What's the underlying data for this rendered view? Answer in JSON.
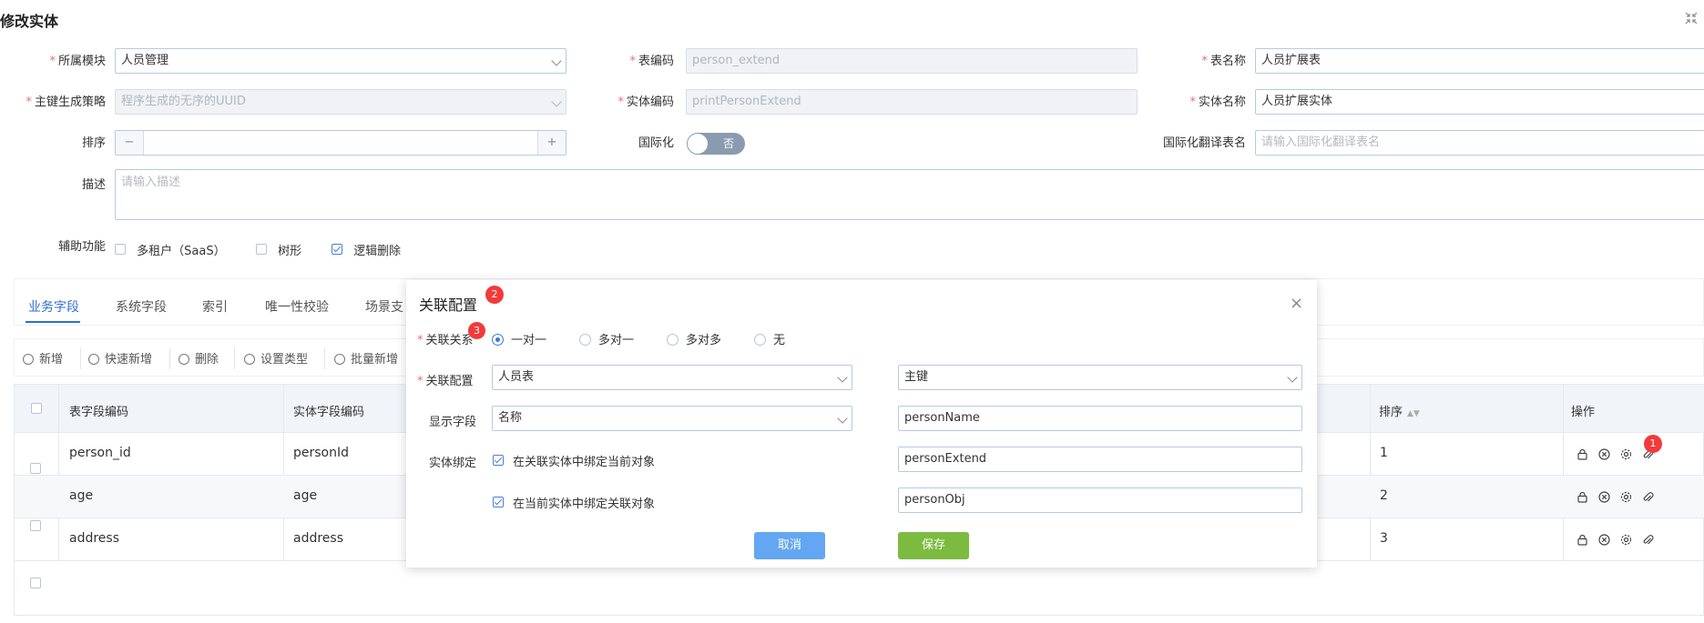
{
  "page": {
    "title": "修改实体"
  },
  "form": {
    "module": {
      "label": "所属模块",
      "value": "人员管理"
    },
    "table_code": {
      "label": "表编码",
      "value": "person_extend"
    },
    "table_name": {
      "label": "表名称",
      "value": "人员扩展表"
    },
    "pk_strategy": {
      "label": "主键生成策略",
      "value": "程序生成的无序的UUID"
    },
    "entity_code": {
      "label": "实体编码",
      "value": "printPersonExtend"
    },
    "entity_name": {
      "label": "实体名称",
      "value": "人员扩展实体"
    },
    "sort": {
      "label": "排序",
      "minus": "−",
      "plus": "+",
      "value": ""
    },
    "i18n": {
      "label": "国际化",
      "toggle_text": "否",
      "enabled": false
    },
    "i18n_table": {
      "label": "国际化翻译表名",
      "placeholder": "请输入国际化翻译表名"
    },
    "description": {
      "label": "描述",
      "placeholder": "请输入描述"
    },
    "aux": {
      "label": "辅助功能",
      "options": [
        {
          "label": "多租户（SaaS）",
          "checked": false
        },
        {
          "label": "树形",
          "checked": false
        },
        {
          "label": "逻辑删除",
          "checked": true
        }
      ]
    }
  },
  "tabs": [
    "业务字段",
    "系统字段",
    "索引",
    "唯一性校验",
    "场景支"
  ],
  "active_tab": "业务字段",
  "toolbar": {
    "add": "新增",
    "quick_add": "快速新增",
    "delete": "删除",
    "set_type": "设置类型",
    "batch_add": "批量新增"
  },
  "table": {
    "headers": {
      "table_field_code": "表字段编码",
      "entity_field_code": "实体字段编码",
      "sort": "排序",
      "actions": "操作"
    },
    "rows": [
      {
        "table_field_code": "person_id",
        "entity_field_code": "personId",
        "sort": "1"
      },
      {
        "table_field_code": "age",
        "entity_field_code": "age",
        "sort": "2"
      },
      {
        "table_field_code": "address",
        "entity_field_code": "address",
        "sort": "3"
      }
    ]
  },
  "modal": {
    "title": "关联配置",
    "title_badge": "2",
    "relation": {
      "label": "关联关系",
      "badge": "3",
      "options": [
        "一对一",
        "多对一",
        "多对多",
        "无"
      ],
      "selected": "一对一"
    },
    "config": {
      "label": "关联配置",
      "entity": "人员表",
      "key": "主键"
    },
    "display": {
      "label": "显示字段",
      "field": "名称",
      "value": "personName"
    },
    "binding": {
      "label": "实体绑定",
      "bind_current": {
        "label": "在关联实体中绑定当前对象",
        "checked": true,
        "value": "personExtend"
      },
      "bind_related": {
        "label": "在当前实体中绑定关联对象",
        "checked": true,
        "value": "personObj"
      }
    },
    "cancel": "取消",
    "save": "保存"
  },
  "action_badge": "1",
  "colors": {
    "primary": "#2f6fd6",
    "danger": "#f23a3a",
    "cancel": "#63a7f2",
    "save": "#7cbb3f"
  }
}
